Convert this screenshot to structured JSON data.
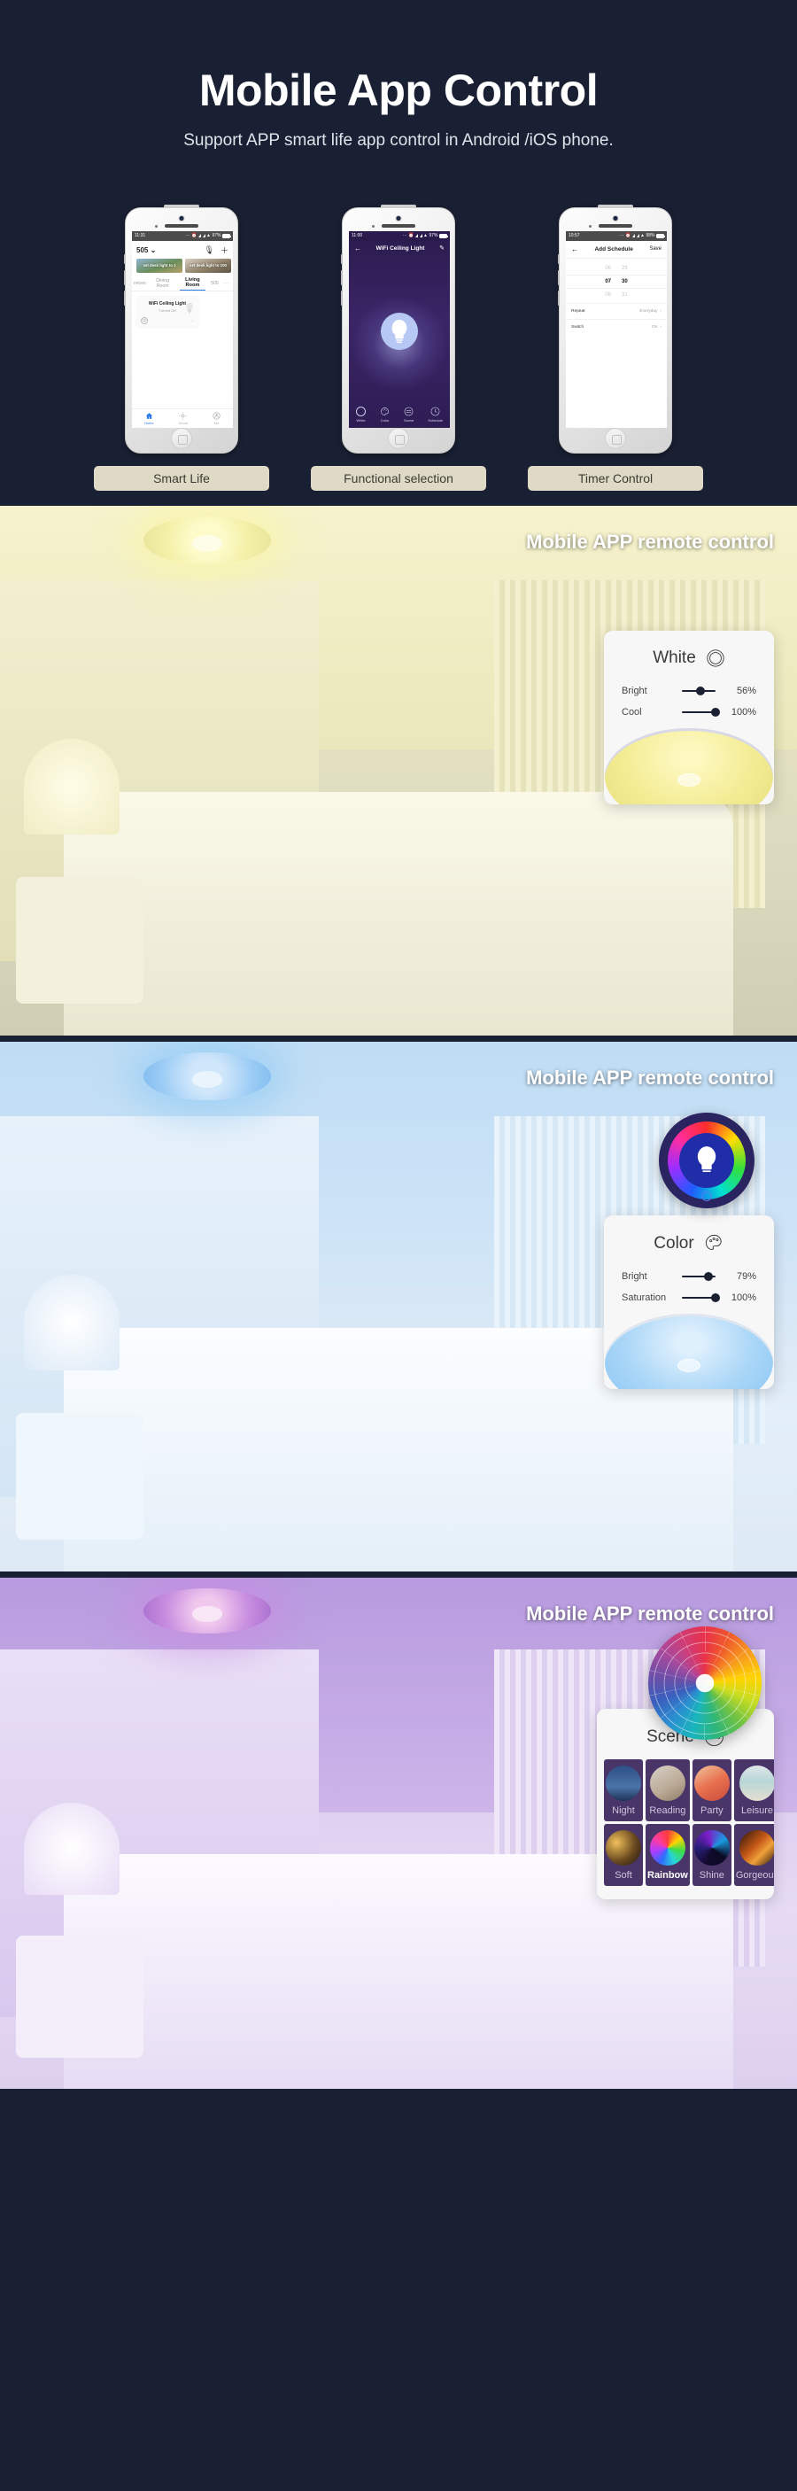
{
  "hero": {
    "title": "Mobile App Control",
    "subtitle": "Support APP smart life app control in Android /iOS phone."
  },
  "phones": [
    {
      "caption": "Smart Life",
      "status": {
        "time": "11:31",
        "battery": "97%"
      },
      "home_name": "505",
      "mic_icon": "microphone-icon",
      "add_icon": "plus-icon",
      "scene_cards": [
        {
          "label": "set desk light to 1"
        },
        {
          "label": "set desk light to 100"
        },
        {
          "label": ""
        }
      ],
      "tabs": [
        {
          "label": "rvices",
          "active": false
        },
        {
          "label": "Dining Room",
          "active": false
        },
        {
          "label": "Living Room",
          "active": true
        },
        {
          "label": "505",
          "active": false
        },
        {
          "label": "···",
          "active": false
        }
      ],
      "device": {
        "name": "WiFi Ceiling Light",
        "status": "Turned Off",
        "power_icon": "power-icon",
        "chevron_icon": "chevron-down-icon"
      },
      "nav": [
        {
          "label": "Home",
          "icon": "home-icon",
          "active": true
        },
        {
          "label": "Smart",
          "icon": "sun-icon",
          "active": false
        },
        {
          "label": "Me",
          "icon": "person-icon",
          "active": false
        }
      ]
    },
    {
      "caption": "Functional selection",
      "status": {
        "time": "11:00",
        "battery": "97%"
      },
      "title": "WiFi Ceiling Light",
      "back_icon": "back-arrow-icon",
      "edit_icon": "pencil-icon",
      "bulb_icon": "bulb-icon",
      "bottom": [
        {
          "label": "White",
          "icon": "ring-icon"
        },
        {
          "label": "Color",
          "icon": "palette-icon"
        },
        {
          "label": "Scene",
          "icon": "lines-icon"
        },
        {
          "label": "Schedule",
          "icon": "clock-icon"
        }
      ]
    },
    {
      "caption": "Timer Control",
      "status": {
        "time": "10:57",
        "battery": "98%"
      },
      "title": "Add Schedule",
      "back_icon": "back-arrow-icon",
      "save_label": "Save",
      "time_rows": [
        {
          "hour": "06",
          "minute": "29",
          "selected": false
        },
        {
          "hour": "07",
          "minute": "30",
          "selected": true
        },
        {
          "hour": "08",
          "minute": "31",
          "selected": false
        }
      ],
      "options": [
        {
          "label": "Repeat",
          "value": "Everyday",
          "chevron": "chevron-right-icon"
        },
        {
          "label": "Switch",
          "value": "On",
          "chevron": "chevron-right-icon"
        }
      ]
    }
  ],
  "bands": [
    {
      "label": "Mobile APP remote control",
      "card": {
        "title": "White",
        "title_icon": "ring-icon",
        "sliders": [
          {
            "label": "Bright",
            "value": 56,
            "display": "56%"
          },
          {
            "label": "Cool",
            "value": 100,
            "display": "100%"
          }
        ]
      }
    },
    {
      "label": "Mobile APP remote control",
      "ring_widget": {
        "icon": "bulb-icon"
      },
      "card": {
        "title": "Color",
        "title_icon": "palette-icon",
        "sliders": [
          {
            "label": "Bright",
            "value": 79,
            "display": "79%"
          },
          {
            "label": "Saturation",
            "value": 100,
            "display": "100%"
          }
        ]
      }
    },
    {
      "label": "Mobile APP remote control",
      "wheel": {
        "icon": "color-wheel-icon"
      },
      "card": {
        "title": "Scene",
        "title_icon": "lines-icon",
        "scenes": [
          {
            "label": "Night",
            "selected": false
          },
          {
            "label": "Reading",
            "selected": false
          },
          {
            "label": "Party",
            "selected": false
          },
          {
            "label": "Leisure",
            "selected": false
          },
          {
            "label": "Soft",
            "selected": false
          },
          {
            "label": "Rainbow",
            "selected": true
          },
          {
            "label": "Shine",
            "selected": false
          },
          {
            "label": "Gorgeous",
            "selected": false
          }
        ]
      }
    }
  ],
  "colors": {
    "background": "#1a2033",
    "caption_bg": "#dfdac6",
    "accent": "#2f7ae5",
    "slider": "#1b2133"
  }
}
